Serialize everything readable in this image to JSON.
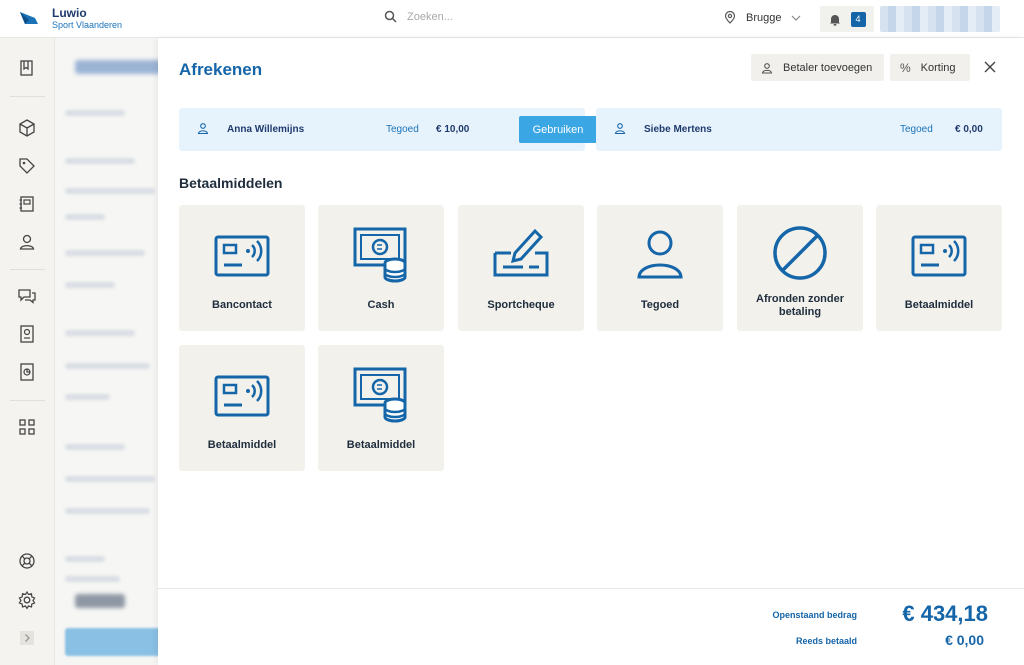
{
  "app": {
    "name": "Luwio",
    "subtitle": "Sport Vlaanderen"
  },
  "search": {
    "placeholder": "Zoeken..."
  },
  "location": {
    "value": "Brugge"
  },
  "notifications": {
    "count": "4"
  },
  "modal": {
    "title": "Afrekenen",
    "add_payer_label": "Betaler toevoegen",
    "discount_label": "Korting"
  },
  "payers": [
    {
      "name": "Anna Willemijns",
      "credit_label": "Tegoed",
      "credit": "€ 10,00",
      "use_label": "Gebruiken"
    },
    {
      "name": "Siebe Mertens",
      "credit_label": "Tegoed",
      "credit": "€ 0,00"
    }
  ],
  "payment_methods_title": "Betaalmiddelen",
  "payment_methods": [
    {
      "label": "Bancontact",
      "icon": "card-contactless-icon"
    },
    {
      "label": "Cash",
      "icon": "cash-coins-icon"
    },
    {
      "label": "Sportcheque",
      "icon": "cheque-pen-icon"
    },
    {
      "label": "Tegoed",
      "icon": "user-icon"
    },
    {
      "label": "Afronden zonder betaling",
      "icon": "no-payment-icon"
    },
    {
      "label": "Betaalmiddel",
      "icon": "card-contactless-icon"
    },
    {
      "label": "Betaalmiddel",
      "icon": "card-contactless-icon"
    },
    {
      "label": "Betaalmiddel",
      "icon": "cash-coins-icon"
    }
  ],
  "footer": {
    "outstanding_label": "Openstaand bedrag",
    "outstanding_value": "€ 434,18",
    "paid_label": "Reeds betaald",
    "paid_value": "€ 0,00"
  },
  "colors": {
    "accent": "#1565a9",
    "button": "#3aa6e3",
    "tile": "#f2f1ec",
    "payer_bg": "#e7f3fc"
  }
}
